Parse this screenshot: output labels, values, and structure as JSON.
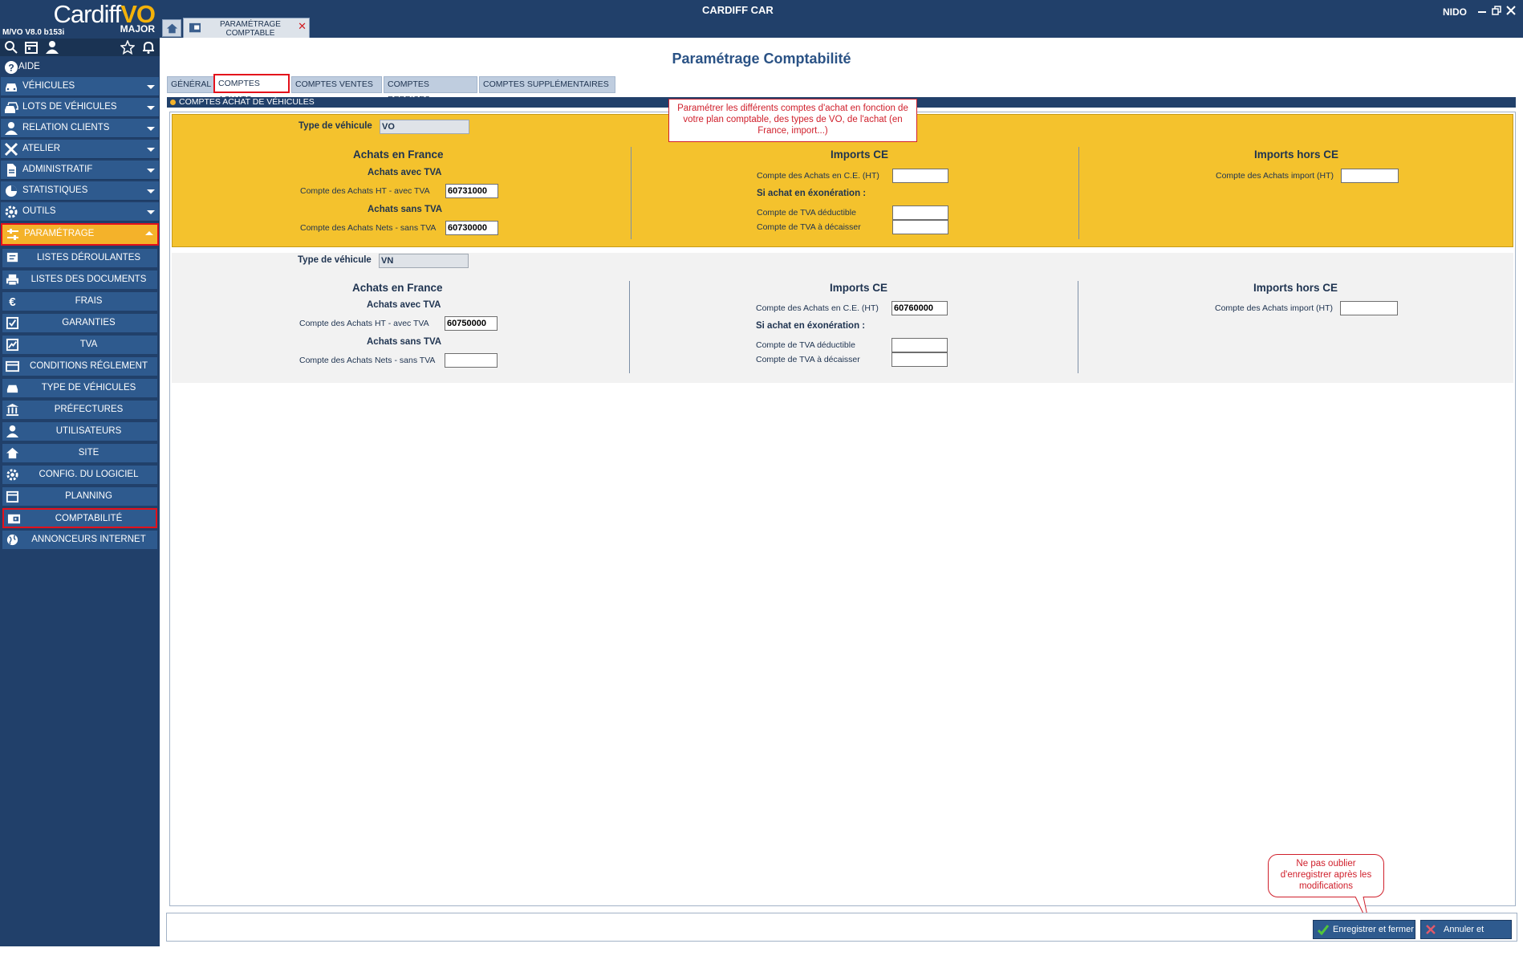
{
  "app": {
    "brand_main": "Cardiff",
    "brand_vo": "VO",
    "edition": "MAJOR",
    "version": "M/VO V8.0 b153i",
    "window_title": "CARDIFF CAR",
    "user": "NIDO"
  },
  "doc_tab": {
    "line1": "PARAMÉTRAGE",
    "line2": "COMPTABLE",
    "close": "✕"
  },
  "sidebar": {
    "help": "AIDE",
    "menu": [
      {
        "label": "VÉHICULES",
        "icon": "car-icon"
      },
      {
        "label": "LOTS DE VÉHICULES",
        "icon": "cars-icon"
      },
      {
        "label": "RELATION CLIENTS",
        "icon": "person-icon"
      },
      {
        "label": "ATELIER",
        "icon": "tools-icon"
      },
      {
        "label": "ADMINISTRATIF",
        "icon": "document-icon"
      },
      {
        "label": "STATISTIQUES",
        "icon": "pie-chart-icon"
      },
      {
        "label": "OUTILS",
        "icon": "gear-icon"
      },
      {
        "label": "PARAMÉTRAGE",
        "icon": "sliders-icon"
      }
    ],
    "sub": [
      {
        "label": "LISTES DÉROULANTES",
        "icon": "list-icon"
      },
      {
        "label": "LISTES DES DOCUMENTS",
        "icon": "printer-icon"
      },
      {
        "label": "FRAIS",
        "icon": "euro-icon"
      },
      {
        "label": "GARANTIES",
        "icon": "check-icon"
      },
      {
        "label": "TVA",
        "icon": "trend-icon"
      },
      {
        "label": "CONDITIONS RÉGLEMENT",
        "icon": "card-icon"
      },
      {
        "label": "TYPE DE VÉHICULES",
        "icon": "car-icon"
      },
      {
        "label": "PRÉFECTURES",
        "icon": "building-icon"
      },
      {
        "label": "UTILISATEURS",
        "icon": "person-icon"
      },
      {
        "label": "SITE",
        "icon": "home-icon"
      },
      {
        "label": "CONFIG. DU LOGICIEL",
        "icon": "gear-icon"
      },
      {
        "label": "PLANNING",
        "icon": "calendar-icon"
      },
      {
        "label": "COMPTABILITÉ",
        "icon": "wallet-icon"
      },
      {
        "label": "ANNONCEURS INTERNET",
        "icon": "globe-icon"
      }
    ]
  },
  "page": {
    "title": "Paramétrage Comptabilité",
    "tabs": [
      "GÉNÉRAL",
      "COMPTES ACHATS",
      "COMPTES VENTES",
      "COMPTES REPRISES",
      "COMPTES SUPPLÉMENTAIRES"
    ],
    "active_tab": "COMPTES ACHATS",
    "section_title": "COMPTES ACHAT DE VÉHICULES"
  },
  "labels": {
    "type_vehicule": "Type de véhicule",
    "achats_france": "Achats en France",
    "achats_avec_tva": "Achats avec TVA",
    "compte_ht_avec_tva": "Compte des Achats HT - avec TVA",
    "achats_sans_tva": "Achats sans TVA",
    "compte_nets_sans_tva": "Compte des Achats Nets - sans TVA",
    "imports_ce": "Imports CE",
    "compte_achats_ce": "Compte des Achats en C.E. (HT)",
    "si_achat_exo": "Si achat en éxonération :",
    "tva_deductible": "Compte de TVA déductible",
    "tva_decaisser": "Compte de TVA à décaisser",
    "imports_hors_ce": "Imports hors CE",
    "compte_achats_import": "Compte des Achats import (HT)"
  },
  "vo": {
    "type": "VO",
    "achats_ht_avec_tva": "60731000",
    "achats_nets_sans_tva": "60730000",
    "achats_ce": "",
    "tva_deductible": "",
    "tva_decaisser": "",
    "achats_import": ""
  },
  "vn": {
    "type": "VN",
    "achats_ht_avec_tva": "60750000",
    "achats_nets_sans_tva": "",
    "achats_ce": "60760000",
    "tva_deductible": "",
    "tva_decaisser": "",
    "achats_import": ""
  },
  "callouts": {
    "top": "Paramétrer les différents comptes d'achat en fonction de votre plan comptable, des types de VO, de l'achat (en France, import...)",
    "bottom": "Ne pas oublier d'enregistrer après les modifications"
  },
  "buttons": {
    "save": "Enregistrer et fermer",
    "cancel": "Annuler et fermer"
  },
  "colors": {
    "nav": "#21406a",
    "accent": "#f4b22a",
    "highlight": "#e3111b"
  }
}
